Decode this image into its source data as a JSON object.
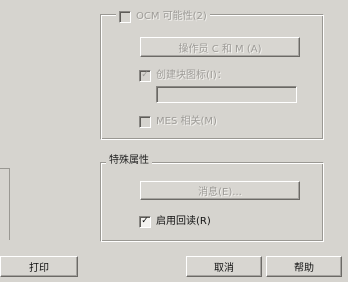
{
  "options": {
    "ocm": {
      "label": "OCM 可能性(2)",
      "checked": false,
      "enabled": false
    },
    "ocm_button": "操作员 C 和 M (A)",
    "create_icon": {
      "label": "创建块图标(I)：",
      "checked": true,
      "enabled": false
    },
    "icon_field_value": "",
    "mes": {
      "label": "MES 相关(M)",
      "checked": false,
      "enabled": false
    }
  },
  "special": {
    "title": "特殊属性",
    "message_button": "消息(E)...",
    "readback": {
      "label": "启用回读(R)",
      "checked": true,
      "enabled": true
    }
  },
  "footer": {
    "print": "打印",
    "cancel": "取消",
    "help": "帮助"
  },
  "colors": {
    "face": "#d6d4cf",
    "disabled_text": "#9e9c98"
  }
}
